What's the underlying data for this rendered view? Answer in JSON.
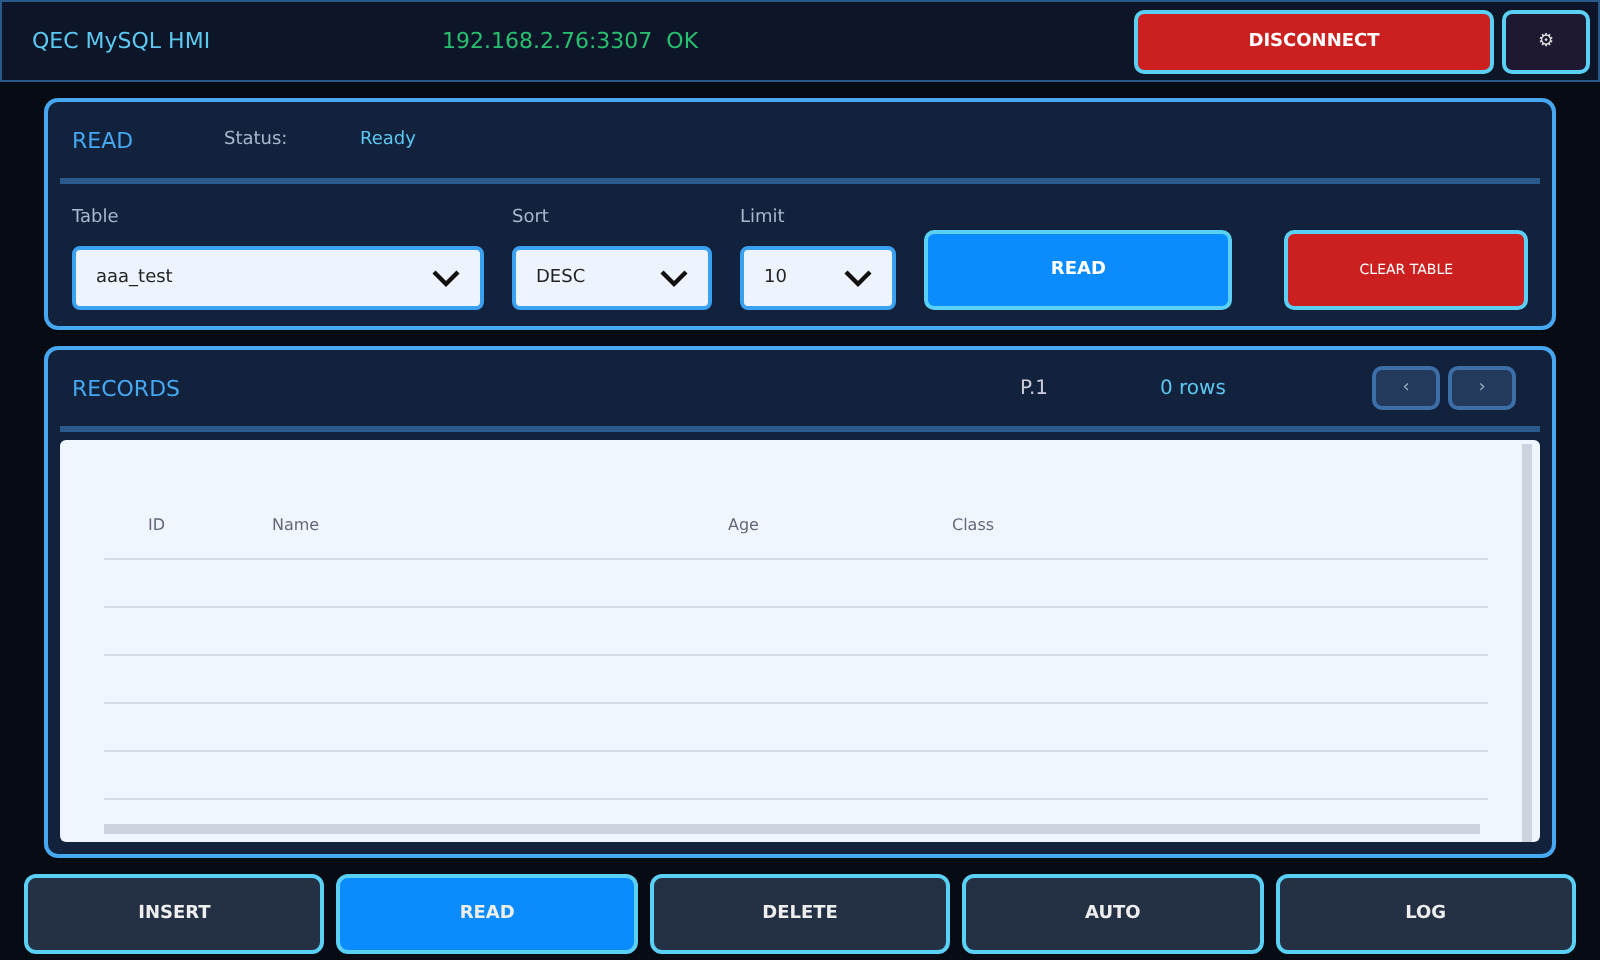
{
  "header": {
    "title": "QEC MySQL HMI",
    "connection": "192.168.2.76:3307  OK",
    "disconnect": "DISCONNECT",
    "settings": "⚙"
  },
  "read_panel": {
    "title": "READ",
    "status_label": "Status:",
    "status": "Ready",
    "fields": [
      {
        "label": "Table",
        "value": "aaa_test"
      },
      {
        "label": "Sort",
        "value": "DESC"
      },
      {
        "label": "Limit",
        "value": "10"
      }
    ],
    "read_button": "READ",
    "clear_button": "CLEAR TABLE"
  },
  "records": {
    "title": "RECORDS",
    "page": "P.1",
    "count": "0 rows",
    "prev": "‹",
    "next": "›",
    "columns": [
      "ID",
      "Name",
      "Age",
      "Class"
    ]
  },
  "nav": [
    {
      "label": "INSERT",
      "selected": false
    },
    {
      "label": "READ",
      "selected": true
    },
    {
      "label": "DELETE",
      "selected": false
    },
    {
      "label": "AUTO",
      "selected": false
    },
    {
      "label": "LOG",
      "selected": false
    }
  ]
}
